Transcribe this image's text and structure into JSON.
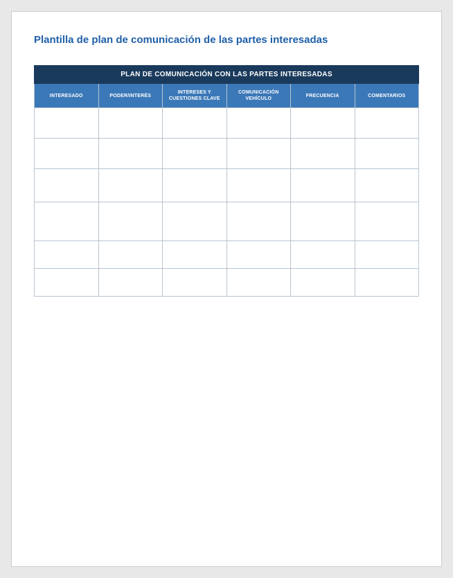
{
  "document": {
    "title": "Plantilla de plan de comunicación de las partes interesadas"
  },
  "table": {
    "mainHeader": "PLAN DE COMUNICACIÓN CON LAS PARTES INTERESADAS",
    "columns": [
      "INTERESADO",
      "PODER/INTERÉS",
      "INTERESES Y CUESTIONES CLAVE",
      "COMUNICACIÓN VEHÍCULO",
      "FRECUENCIA",
      "COMENTARIOS"
    ],
    "rows": [
      [
        "",
        "",
        "",
        "",
        "",
        ""
      ],
      [
        "",
        "",
        "",
        "",
        "",
        ""
      ],
      [
        "",
        "",
        "",
        "",
        "",
        ""
      ],
      [
        "",
        "",
        "",
        "",
        "",
        ""
      ],
      [
        "",
        "",
        "",
        "",
        "",
        ""
      ],
      [
        "",
        "",
        "",
        "",
        "",
        ""
      ]
    ]
  }
}
